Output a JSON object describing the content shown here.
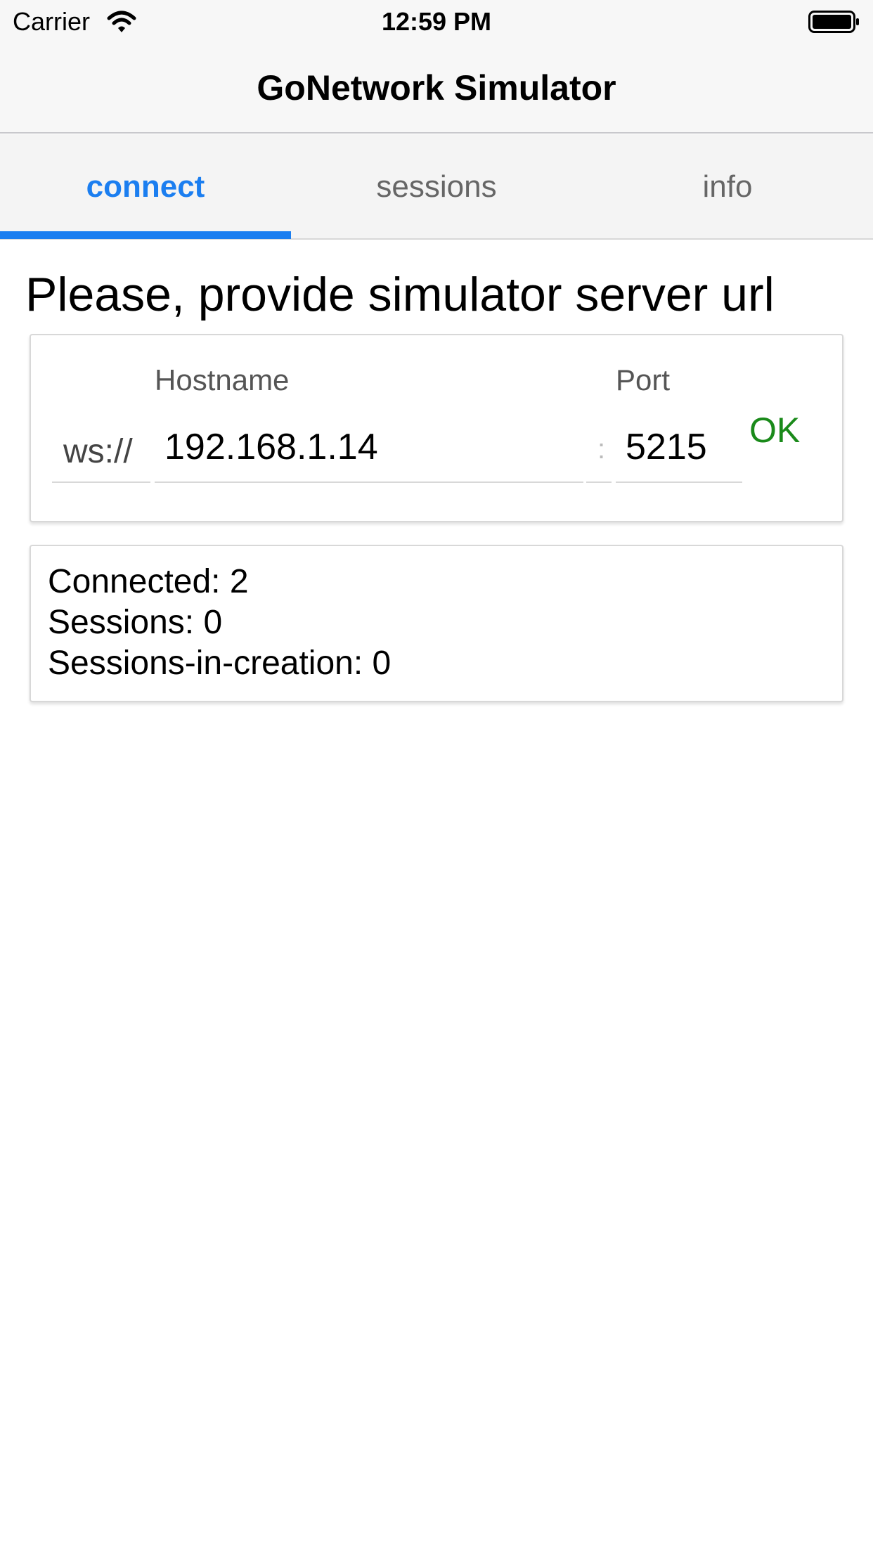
{
  "status_bar": {
    "carrier": "Carrier",
    "time": "12:59 PM"
  },
  "nav": {
    "title": "GoNetwork Simulator"
  },
  "tabs": [
    {
      "label": "connect",
      "active": true
    },
    {
      "label": "sessions",
      "active": false
    },
    {
      "label": "info",
      "active": false
    }
  ],
  "accent_color": "#1b7ef0",
  "ok_color": "#1a8a1a",
  "heading": "Please, provide simulator server url",
  "url_form": {
    "prefix": "ws://",
    "hostname_label": "Hostname",
    "hostname_value": "192.168.1.14",
    "separator": ":",
    "port_label": "Port",
    "port_value": "5215",
    "ok_label": "OK"
  },
  "stats": {
    "connected": "Connected: 2",
    "sessions": "Sessions: 0",
    "sessions_in_creation": "Sessions-in-creation: 0"
  }
}
